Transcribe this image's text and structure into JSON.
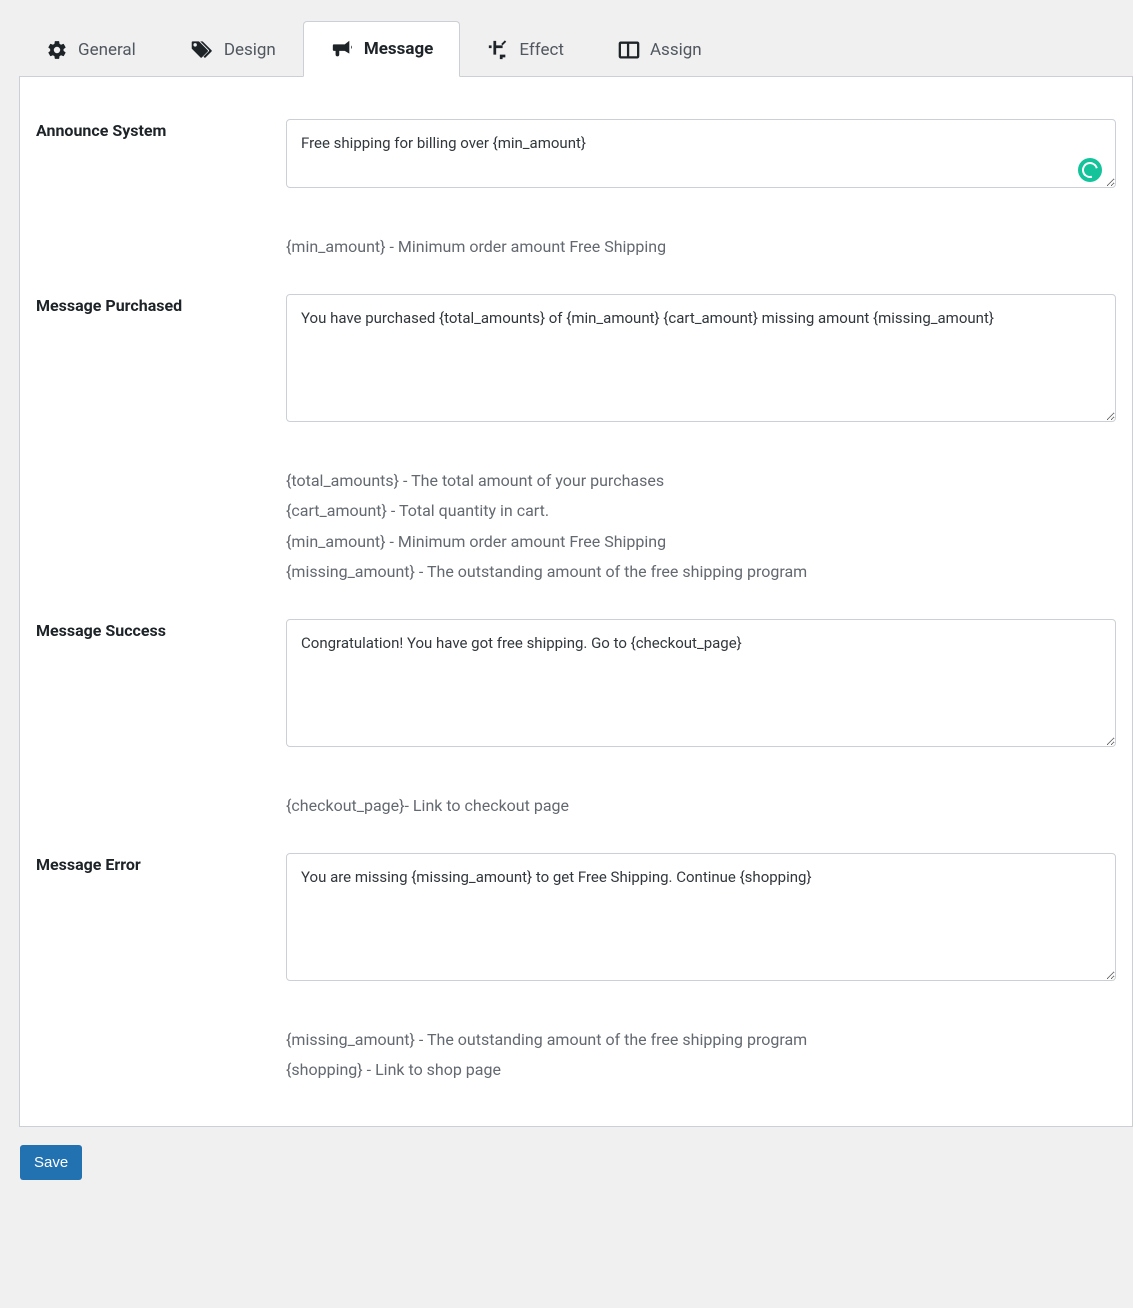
{
  "tabs": {
    "general": "General",
    "design": "Design",
    "message": "Message",
    "effect": "Effect",
    "assign": "Assign"
  },
  "active_tab": "message",
  "fields": {
    "announce": {
      "label": "Announce System",
      "value": "Free shipping for billing over {min_amount}",
      "hints": [
        "{min_amount} - Minimum order amount Free Shipping"
      ]
    },
    "purchased": {
      "label": "Message Purchased",
      "value": "You have purchased {total_amounts} of {min_amount} {cart_amount} missing amount {missing_amount}",
      "hints": [
        "{total_amounts} - The total amount of your purchases",
        "{cart_amount} - Total quantity in cart.",
        "{min_amount} - Minimum order amount Free Shipping",
        "{missing_amount} - The outstanding amount of the free shipping program"
      ]
    },
    "success": {
      "label": "Message Success",
      "value": "Congratulation! You have got free shipping. Go to {checkout_page}",
      "hints": [
        "{checkout_page}- Link to checkout page"
      ]
    },
    "error": {
      "label": "Message Error",
      "value": "You are missing {missing_amount} to get Free Shipping. Continue {shopping}",
      "hints": [
        "{missing_amount} - The outstanding amount of the free shipping program",
        "{shopping} - Link to shop page"
      ]
    }
  },
  "save_label": "Save"
}
